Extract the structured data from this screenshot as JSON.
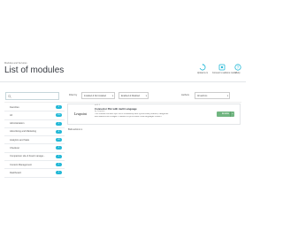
{
  "header": {
    "breadcrumb": "Modules and Services",
    "title": "List of modules",
    "toolbar": [
      {
        "label": "Upload a m",
        "icon": "refresh-icon"
      },
      {
        "label": "Connect to addons market",
        "icon": "puzzle-icon"
      },
      {
        "label": "Help",
        "icon": "help-icon"
      }
    ]
  },
  "filters": {
    "search_placeholder": "",
    "filter_by_label": "Filter by",
    "installed_select": "Installed & Not installed",
    "status_select": "Enabled & Disabled",
    "authors_label": "Authors",
    "authors_select": "All authors"
  },
  "sidebar": {
    "items": [
      {
        "label": "Favorites",
        "count": "0"
      },
      {
        "label": "All",
        "count": "124"
      },
      {
        "label": "Administration",
        "count": "3"
      },
      {
        "label": "Advertising and Marketing",
        "count": "8"
      },
      {
        "label": "Analytics and Stats",
        "count": "32"
      },
      {
        "label": "Checkout",
        "count": "3"
      },
      {
        "label": "Comparison site & Feed manage...",
        "count": "2"
      },
      {
        "label": "Content Management",
        "count": "3"
      },
      {
        "label": "Dashboard",
        "count": "5"
      }
    ]
  },
  "module": {
    "logo_text": "Leapoint",
    "version": "v0.1.1",
    "name": "Connector Pim with multi Language",
    "author": "by Leapoint",
    "description_lines": [
      "This module connect Api PIM to Prestashop and synchronise products, categories",
      "and features with images. It allows to synchronise multi languages content"
    ],
    "enable_label": "Enable"
  },
  "bulk_actions_label": "Bulk actions"
}
